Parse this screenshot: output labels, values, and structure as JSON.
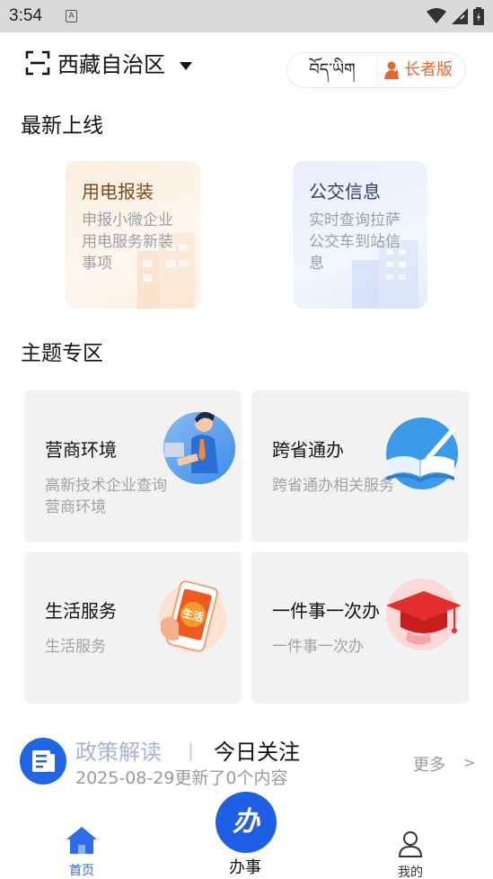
{
  "status_bar": {
    "time": "3:54",
    "sim_label": "A"
  },
  "header": {
    "region": "西藏自治区",
    "lang_tibetan": "བོད་ཡིག",
    "elder_mode": "长者版"
  },
  "sections": {
    "new_online": "最新上线",
    "themes": "主题专区"
  },
  "new_cards": [
    {
      "title": "用电报装",
      "desc": "申报小微企业用电服务新装事项"
    },
    {
      "title": "公交信息",
      "desc": "实时查询拉萨公交车到站信息"
    }
  ],
  "theme_cards": [
    {
      "title": "营商环境",
      "desc": "高新技术企业查询营商环境",
      "icon": "businessman-icon"
    },
    {
      "title": "跨省通办",
      "desc": "跨省通办相关服务",
      "icon": "book-quill-icon"
    },
    {
      "title": "生活服务",
      "desc": "生活服务",
      "icon": "phone-life-icon",
      "badge": "生活"
    },
    {
      "title": "一件事一次办",
      "desc": "一件事一次办",
      "icon": "graduation-cap-icon"
    }
  ],
  "news": {
    "tab_policy": "政策解读",
    "separator": "|",
    "tab_today": "今日关注",
    "more": "更多",
    "more_arrow": ">",
    "updated": "2025-08-29更新了0个内容"
  },
  "tabbar": {
    "home": "首页",
    "center_glyph": "办",
    "center": "办事",
    "mine": "我的"
  },
  "colors": {
    "accent_blue": "#1e5fe6",
    "elder_orange": "#e8672d"
  }
}
